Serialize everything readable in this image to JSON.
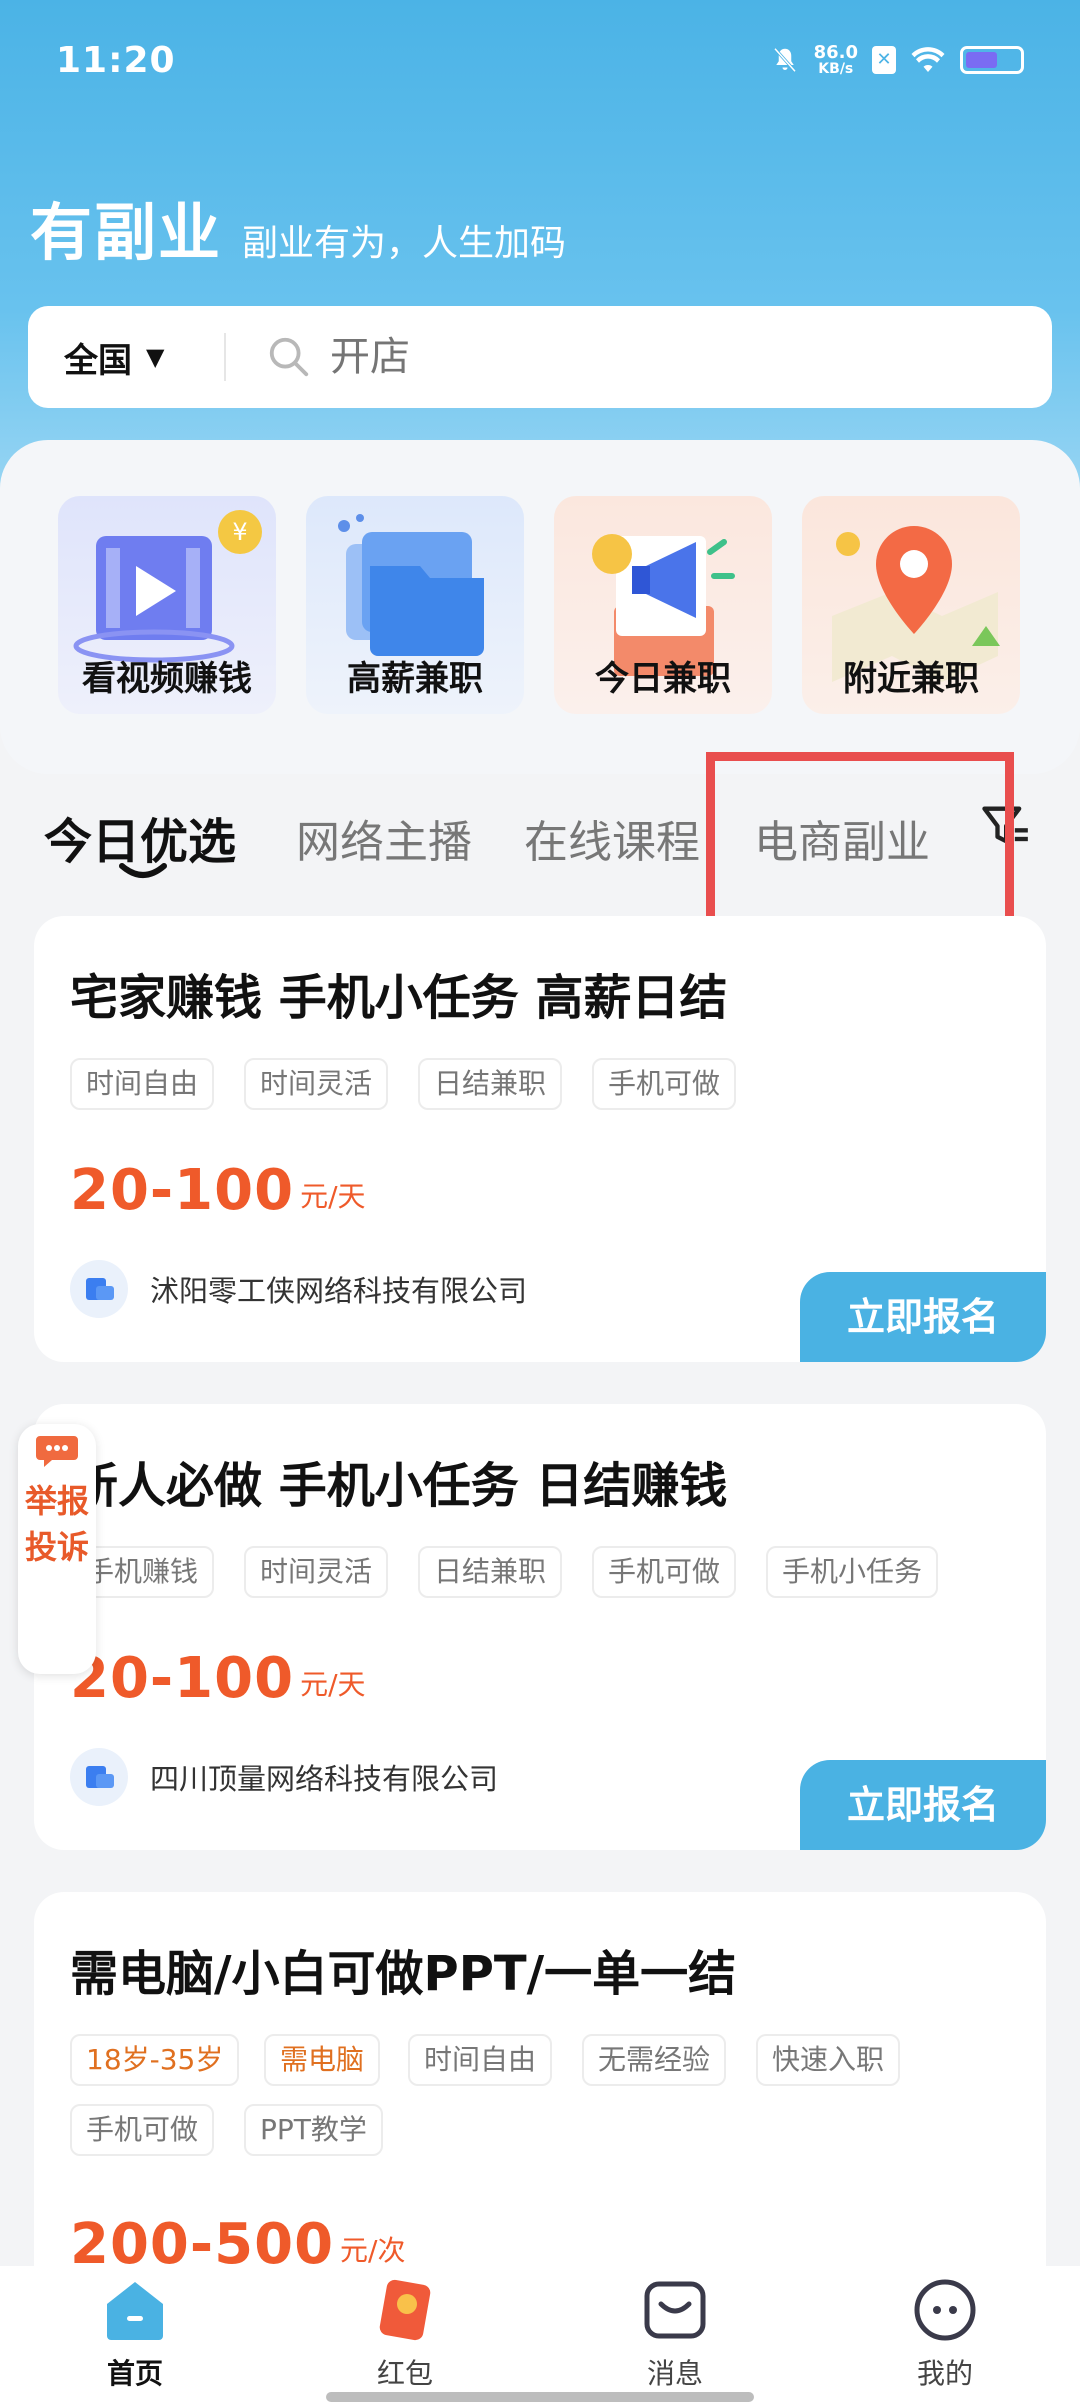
{
  "status": {
    "time": "11:20",
    "speed_value": "86.0",
    "speed_unit": "KB/s",
    "x_badge": "✕"
  },
  "brand": {
    "title": "有副业",
    "slogan": "副业有为，人生加码"
  },
  "search": {
    "region": "全国",
    "placeholder": "开店"
  },
  "categories": [
    {
      "label": "看视频赚钱",
      "icon": "video-money-icon"
    },
    {
      "label": "高薪兼职",
      "icon": "folder-icon"
    },
    {
      "label": "今日兼职",
      "icon": "megaphone-icon"
    },
    {
      "label": "附近兼职",
      "icon": "map-pin-icon"
    }
  ],
  "tabs": [
    {
      "label": "今日优选",
      "active": true
    },
    {
      "label": "网络主播",
      "active": false
    },
    {
      "label": "在线课程",
      "active": false
    },
    {
      "label": "电商副业",
      "active": false
    }
  ],
  "jobs": [
    {
      "title": "宅家赚钱 手机小任务 高薪日结",
      "tags": [
        "时间自由",
        "时间灵活",
        "日结兼职",
        "手机可做"
      ],
      "salary": "20-100",
      "unit": "元/天",
      "company": "沭阳零工侠网络科技有限公司",
      "apply": "立即报名"
    },
    {
      "title": "新人必做 手机小任务 日结赚钱",
      "tags": [
        "手机赚钱",
        "时间灵活",
        "日结兼职",
        "手机可做",
        "手机小任务"
      ],
      "salary": "20-100",
      "unit": "元/天",
      "company": "四川顶量网络科技有限公司",
      "apply": "立即报名"
    },
    {
      "title": "需电脑/小白可做PPT/一单一结",
      "tags": [
        "18岁-35岁",
        "需电脑",
        "时间自由",
        "无需经验",
        "快速入职",
        "手机可做",
        "PPT教学"
      ],
      "salary": "200-500",
      "unit": "元/次"
    }
  ],
  "report": {
    "label": "举报投诉"
  },
  "nav": [
    {
      "label": "首页",
      "icon": "home-icon",
      "active": true
    },
    {
      "label": "红包",
      "icon": "red-packet-icon",
      "active": false
    },
    {
      "label": "消息",
      "icon": "message-icon",
      "active": false
    },
    {
      "label": "我的",
      "icon": "profile-icon",
      "active": false
    }
  ],
  "colors": {
    "brand_blue": "#4ab2e3",
    "salary_orange": "#ef5a2a",
    "highlight_red": "#e94e4e"
  }
}
